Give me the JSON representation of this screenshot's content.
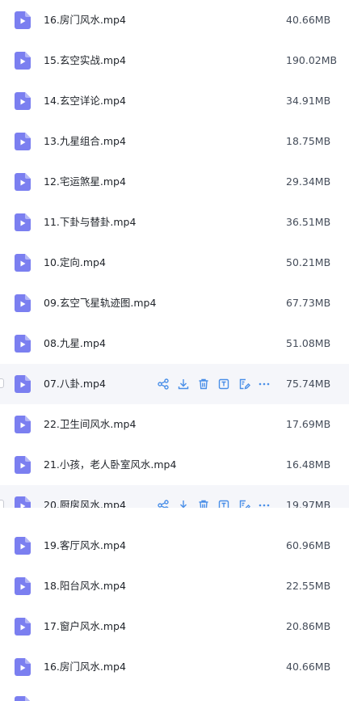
{
  "files": [
    {
      "name": "16.房门风水.mp4",
      "size": "40.66MB"
    },
    {
      "name": "15.玄空实战.mp4",
      "size": "190.02MB"
    },
    {
      "name": "14.玄空详论.mp4",
      "size": "34.91MB"
    },
    {
      "name": "13.九星组合.mp4",
      "size": "18.75MB"
    },
    {
      "name": "12.宅运煞星.mp4",
      "size": "29.34MB"
    },
    {
      "name": "11.下卦与替卦.mp4",
      "size": "36.51MB"
    },
    {
      "name": "10.定向.mp4",
      "size": "50.21MB"
    },
    {
      "name": "09.玄空飞星轨迹图.mp4",
      "size": "67.73MB"
    },
    {
      "name": "08.九星.mp4",
      "size": "51.08MB"
    },
    {
      "name": "07.八卦.mp4",
      "size": "75.74MB"
    },
    {
      "name": "22.卫生间风水.mp4",
      "size": "17.69MB"
    },
    {
      "name": "21.小孩，老人卧室风水.mp4",
      "size": "16.48MB"
    },
    {
      "name": "20.厨房风水.mp4",
      "size": "19.97MB"
    },
    {
      "name": "19.客厅风水.mp4",
      "size": "60.96MB"
    },
    {
      "name": "18.阳台风水.mp4",
      "size": "22.55MB"
    },
    {
      "name": "17.窗户风水.mp4",
      "size": "20.86MB"
    },
    {
      "name": "16.房门风水.mp4",
      "size": "40.66MB"
    }
  ],
  "colors": {
    "file_icon": "#7b7ff0",
    "action_icon": "#4a8fe8",
    "hover_bg": "#f5f6fa"
  },
  "icons": {
    "file": "video-file-icon",
    "actions": [
      "share-icon",
      "download-icon",
      "delete-icon",
      "text-extract-icon",
      "edit-icon",
      "more-icon"
    ]
  }
}
